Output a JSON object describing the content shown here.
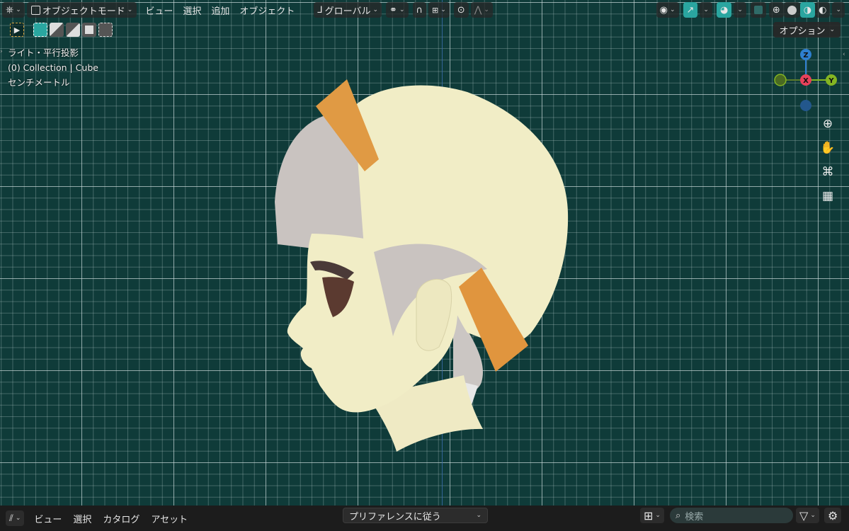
{
  "header": {
    "mode_label": "オブジェクトモード",
    "menus": [
      "ビュー",
      "選択",
      "追加",
      "オブジェクト"
    ],
    "orientation_label": "グローバル"
  },
  "overlay": {
    "line1": "ライト・平行投影",
    "line2": "(0) Collection | Cube",
    "line3": "センチメートル"
  },
  "options_label": "オプション",
  "gizmo": {
    "z": "Z",
    "x": "X",
    "y": "Y"
  },
  "footer": {
    "menus": [
      "ビュー",
      "選択",
      "カタログ",
      "アセット"
    ],
    "dropdown_label": "プリファレンスに従う",
    "search_placeholder": "検索"
  },
  "colors": {
    "accent": "#2aa6a0",
    "gizmo_x": "#e8415a",
    "gizmo_y": "#84b522",
    "gizmo_z": "#2e7fd0",
    "skin": "#f1edc6",
    "hair": "#c9c3bf",
    "ribbon": "#e09a44"
  }
}
